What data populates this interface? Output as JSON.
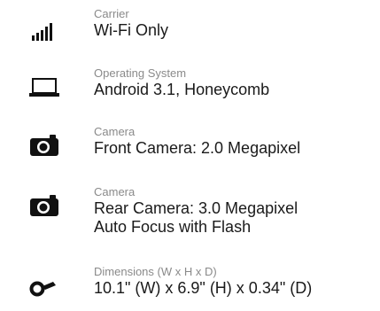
{
  "specs": [
    {
      "icon": "signal-bars-icon",
      "label": "Carrier",
      "value": "Wi-Fi Only"
    },
    {
      "icon": "laptop-icon",
      "label": "Operating System",
      "value": "Android 3.1, Honeycomb"
    },
    {
      "icon": "camera-icon",
      "label": "Camera",
      "value": "Front Camera: 2.0 Megapixel"
    },
    {
      "icon": "camera-icon",
      "label": "Camera",
      "value_lines": [
        "Rear Camera: 3.0 Megapixel",
        "Auto Focus with Flash"
      ]
    },
    {
      "icon": "tag-icon",
      "label": "Dimensions (W x H x D)",
      "value": "10.1\" (W) x 6.9\" (H) x 0.34\" (D)"
    }
  ]
}
